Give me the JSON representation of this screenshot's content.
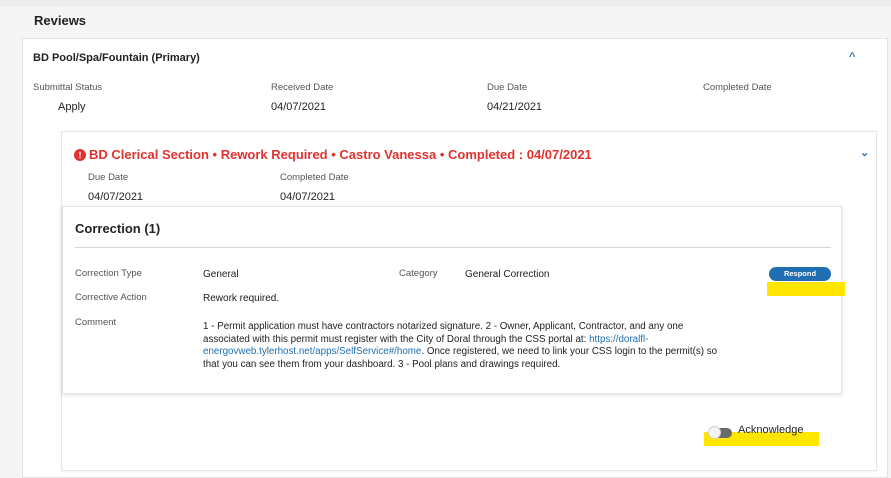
{
  "page": {
    "title": "Reviews"
  },
  "review": {
    "name": "BD Pool/Spa/Fountain (Primary)",
    "fields": [
      {
        "label": "Submittal Status",
        "value": "Apply"
      },
      {
        "label": "Received Date",
        "value": "04/07/2021"
      },
      {
        "label": "Due Date",
        "value": "04/21/2021"
      },
      {
        "label": "Completed Date",
        "value": ""
      }
    ],
    "section": {
      "title": "BD Clerical Section • Rework Required • Castro Vanessa  • Completed : 04/07/2021",
      "fields": [
        {
          "label": "Due Date",
          "value": "04/07/2021"
        },
        {
          "label": "Completed Date",
          "value": "04/07/2021"
        }
      ],
      "correction": {
        "title": "Correction (1)",
        "type_label": "Correction Type",
        "type_value": "General",
        "category_label": "Category",
        "category_value": "General Correction",
        "action_label": "Corrective Action",
        "action_value": "Rework required.",
        "comment_label": "Comment",
        "comment_part1": "1 - Permit application must have contractors notarized signature. 2 - Owner, Applicant, Contractor, and any one associated with this permit must register with the City of Doral through the CSS portal at: ",
        "comment_link": "https://doralfl-energovweb.tylerhost.net/apps/SelfService#/home",
        "comment_part2": ". Once registered, we need to link your CSS login to the permit(s) so that you can see them from your dashboard. 3 - Pool plans and drawings required.",
        "respond_label": "Respond"
      },
      "acknowledge_label": "Acknowledge"
    }
  },
  "colors": {
    "accent": "#1f6fb2",
    "error": "#e0332f",
    "highlight": "#ffe600"
  },
  "icons": {
    "chevron_up": "^",
    "chevron_down": "⌄",
    "error": "!"
  }
}
